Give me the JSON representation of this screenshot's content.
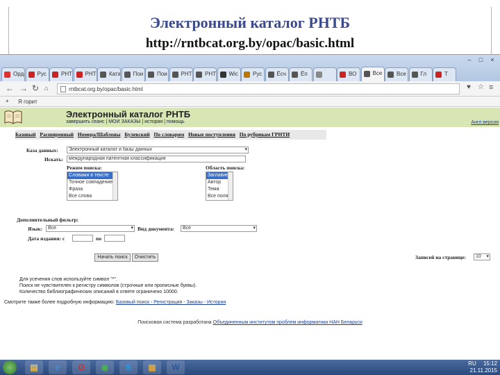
{
  "slide": {
    "title": "Электронный каталог РНТБ",
    "url": "http://rntbcat.org.by/opac/basic.html"
  },
  "browser": {
    "tabs": [
      {
        "label": "Орда",
        "color": "#d33"
      },
      {
        "label": "Рус",
        "color": "#c22"
      },
      {
        "label": "РНТ",
        "color": "#c22"
      },
      {
        "label": "РНТ",
        "color": "#c22"
      },
      {
        "label": "Ката",
        "color": "#555"
      },
      {
        "label": "Пои",
        "color": "#555"
      },
      {
        "label": "Пои",
        "color": "#555"
      },
      {
        "label": "РНТ",
        "color": "#555"
      },
      {
        "label": "РНТ",
        "color": "#555"
      },
      {
        "label": "Wic",
        "color": "#333"
      },
      {
        "label": "Рус",
        "color": "#b70"
      },
      {
        "label": "Ёсч",
        "color": "#555"
      },
      {
        "label": "Ëп",
        "color": "#555"
      },
      {
        "label": "",
        "color": "#888"
      },
      {
        "label": "ВО",
        "color": "#c22"
      },
      {
        "label": "Все",
        "color": "#555"
      },
      {
        "label": "Все",
        "color": "#555"
      },
      {
        "label": "Гл",
        "color": "#555"
      },
      {
        "label": "Т",
        "color": "#c22"
      }
    ],
    "address": "rntbcat.org.by/opac/basic.html",
    "bookmark": "Я горит",
    "window_buttons": [
      "–",
      "□",
      "×"
    ],
    "icons": {
      "menu": "≡",
      "star": "☆",
      "heart": "♥"
    }
  },
  "opac": {
    "title": "Электронный каталог РНТБ",
    "links": "завершить сеанс | МОИ ЗАКАЗЫ | история | помощь",
    "ext_link": "Англ.версия",
    "tabs": [
      "Базовый",
      "Расширенный",
      "Номера/Шаблоны",
      "Булевский",
      "По словарям",
      "Новые поступления",
      "По рубрикам ГРНТИ"
    ],
    "db_label": "База данных:",
    "db_value": "Электронный каталог и базы данных",
    "search_label": "Искать:",
    "search_value": "международная патентная классификация",
    "mode_label": "Режим поиска:",
    "mode_options": [
      "Словами в тексте",
      "Точное совпадение",
      "Фраза",
      "Все слова"
    ],
    "area_label": "Область поиска:",
    "area_options": [
      "Заглавие",
      "Автор",
      "Тема",
      "Все поля"
    ],
    "filter_label": "Дополнительный фильтр:",
    "lang_label": "Язык:",
    "lang_value": "Все",
    "doctype_label": "Вид документа:",
    "doctype_value": "Все",
    "date_label": "Дата издания: с",
    "date_to": "по",
    "search_button": "Начать поиск",
    "clear_button": "Очистить",
    "per_page_label": "Записей на странице:",
    "per_page_value": "10",
    "notes": [
      "Для усечения слов используйте символ \"*\".",
      "Поиск не чувствителен к регистру символов (строчные или прописные буквы).",
      "Количество библиографических описаний в ответе ограничено 10000."
    ],
    "see_also": "Смотрите также более подробную информацию:",
    "see_links": "Базовый поиск - Регистрация - Заказы - История",
    "footer_text": "Поисковая система разработана",
    "footer_link": "Объединенным институтом проблем информатики НАН Беларуси"
  },
  "taskbar": {
    "apps": [
      {
        "name": "folder",
        "glyph": "▤",
        "color": "#e8c25a"
      },
      {
        "name": "ie",
        "glyph": "e",
        "color": "#3b8ee0"
      },
      {
        "name": "opera",
        "glyph": "O",
        "color": "#d62b2b"
      },
      {
        "name": "chrome",
        "glyph": "◉",
        "color": "#4caf50"
      },
      {
        "name": "skype",
        "glyph": "S",
        "color": "#1da1f2"
      },
      {
        "name": "paint",
        "glyph": "▦",
        "color": "#d9a441"
      },
      {
        "name": "word",
        "glyph": "W",
        "color": "#2b579a"
      }
    ],
    "lang": "RU",
    "time": "15:12",
    "date": "21.11.2015"
  }
}
